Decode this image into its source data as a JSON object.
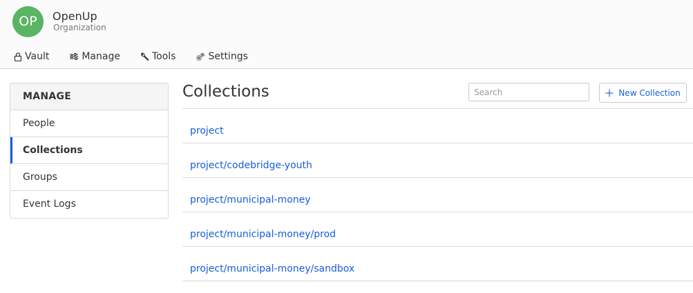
{
  "org": {
    "initials": "OP",
    "name": "OpenUp",
    "type": "Organization"
  },
  "nav": [
    {
      "label": "Vault",
      "icon": "lock-icon"
    },
    {
      "label": "Manage",
      "icon": "sliders-icon"
    },
    {
      "label": "Tools",
      "icon": "wrench-icon"
    },
    {
      "label": "Settings",
      "icon": "gears-icon"
    }
  ],
  "sidebar": {
    "heading": "MANAGE",
    "items": [
      {
        "label": "People"
      },
      {
        "label": "Collections"
      },
      {
        "label": "Groups"
      },
      {
        "label": "Event Logs"
      }
    ],
    "active": "Collections"
  },
  "main": {
    "title": "Collections",
    "search_placeholder": "Search",
    "new_button": "New Collection",
    "collections": [
      "project",
      "project/codebridge-youth",
      "project/municipal-money",
      "project/municipal-money/prod",
      "project/municipal-money/sandbox"
    ]
  },
  "colors": {
    "accent": "#175ddc",
    "avatar": "#59b563",
    "border": "#d8d8d8"
  }
}
